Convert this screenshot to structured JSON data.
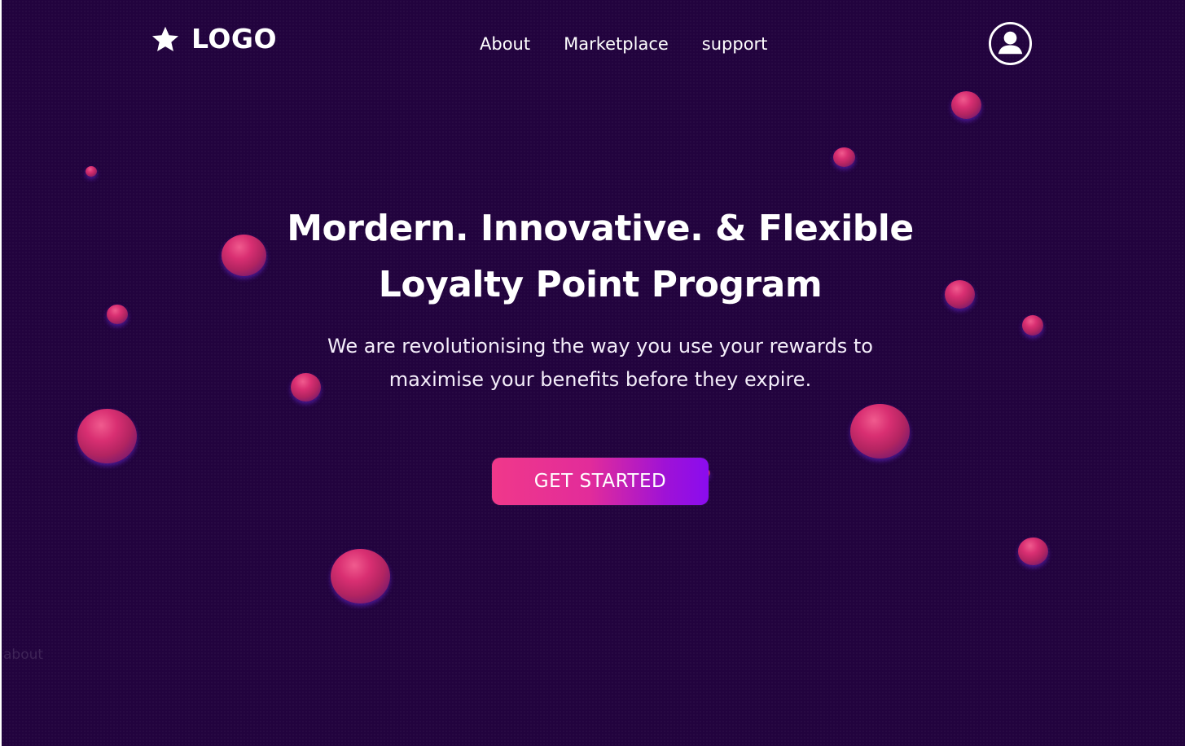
{
  "header": {
    "logo_text": "LOGO",
    "logo_icon": "star-icon",
    "nav": [
      {
        "label": "About"
      },
      {
        "label": "Marketplace"
      },
      {
        "label": "support"
      }
    ],
    "account_icon": "user-circle-icon"
  },
  "hero": {
    "title_line1": "Mordern. Innovative. & Flexible",
    "title_line2": "Loyalty Point Program",
    "subtitle_line1": "We are revolutionising the way you use your rewards to",
    "subtitle_line2": "maximise your benefits before they expire.",
    "cta_label": "GET STARTED"
  },
  "stray_text": "about",
  "colors": {
    "background": "#22033e",
    "accent_pink": "#f0388a",
    "accent_purple": "#8a0cef",
    "sphere": "#d92f72"
  }
}
